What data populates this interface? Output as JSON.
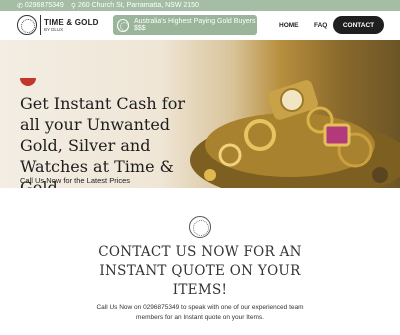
{
  "topbar": {
    "phone": "0296875349",
    "address": "260 Church St, Parramatta, NSW 2150"
  },
  "logo": {
    "name": "TIME & GOLD",
    "tagline": "BY DLUX"
  },
  "promo": {
    "text": "Australia's Highest Paying Gold Buyers $$$"
  },
  "nav": {
    "home": "HOME",
    "faq": "FAQ",
    "contact": "CONTACT"
  },
  "hero": {
    "heading": "Get Instant Cash for all your Unwanted Gold, Silver and Watches at Time & Gold.",
    "subtext": "Call Us Now for the Latest Prices"
  },
  "section": {
    "title": "CONTACT US NOW FOR AN INSTANT QUOTE ON YOUR ITEMS!",
    "text": "Call Us Now on 0296875349 to speak with one of our experienced team members for an Instant quote on your Items."
  },
  "colors": {
    "topbar": "#a5bda5",
    "promo": "#9bb59b",
    "contact_button": "#1f1f1f",
    "badge": "#c2362c"
  },
  "icons": {
    "phone": "phone-icon",
    "location": "location-pin-icon",
    "logo": "ring-logo-icon",
    "promo": "ring-badge-icon"
  }
}
